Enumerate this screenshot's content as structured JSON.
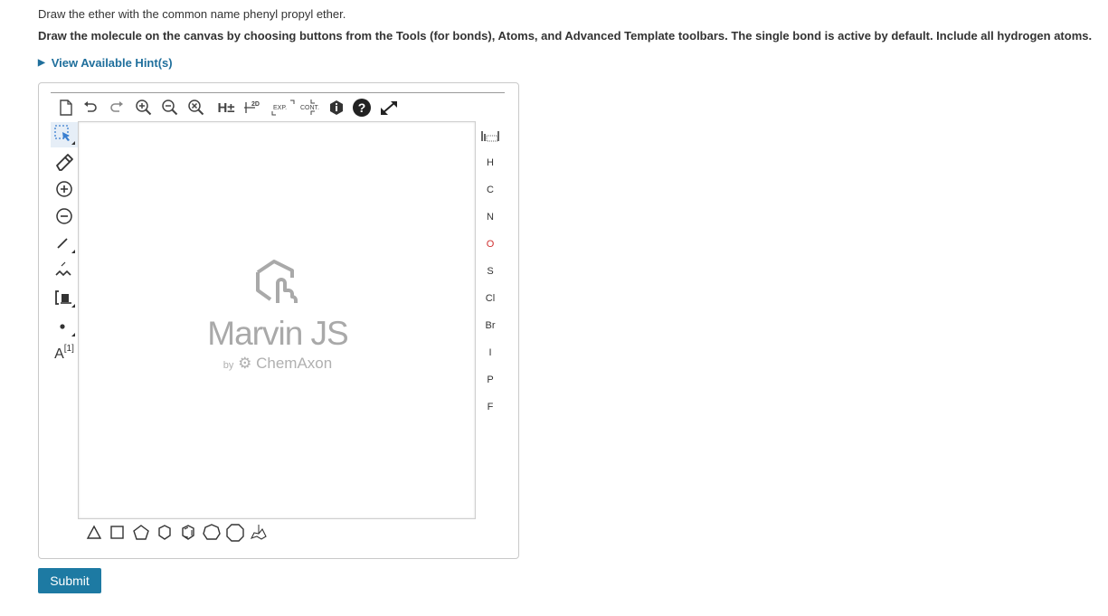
{
  "question": {
    "prompt": "Draw the ether with the common name phenyl propyl ether.",
    "instructions": "Draw the molecule on the canvas by choosing buttons from the Tools (for bonds), Atoms, and Advanced Template toolbars. The single bond is active by default. Include all hydrogen atoms.",
    "hint_link": "View Available Hint(s)"
  },
  "editor": {
    "top_toolbar": {
      "h_toggle": "H±",
      "clean2d": "2D",
      "expand": "EXP.",
      "contract": "CONT."
    },
    "left_toolbar": {
      "atom_map_label": "A",
      "atom_map_index": "[1]"
    },
    "atoms": [
      "H",
      "C",
      "N",
      "O",
      "S",
      "Cl",
      "Br",
      "I",
      "P",
      "F"
    ],
    "atom_colors": {
      "default": "#333333",
      "oxygen": "#d03030"
    },
    "logo": {
      "title": "Marvin JS",
      "by": "by",
      "company": "ChemAxon"
    }
  },
  "submit_label": "Submit"
}
